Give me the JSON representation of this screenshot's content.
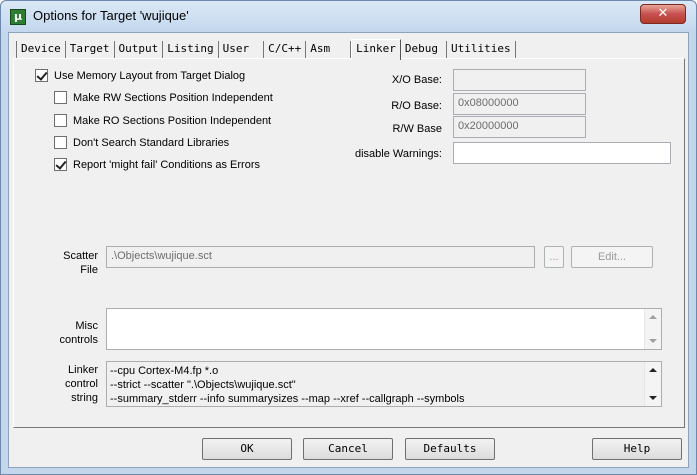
{
  "window": {
    "title": "Options for Target 'wujique'",
    "icon_text": "μ",
    "close_glyph": "✕"
  },
  "tabs": [
    {
      "label": "Device"
    },
    {
      "label": "Target"
    },
    {
      "label": "Output"
    },
    {
      "label": "Listing"
    },
    {
      "label": "User"
    },
    {
      "label": "C/C++"
    },
    {
      "label": "Asm"
    },
    {
      "label": "Linker"
    },
    {
      "label": "Debug"
    },
    {
      "label": "Utilities"
    }
  ],
  "active_tab": "Linker",
  "linker": {
    "use_memory_layout": {
      "label": "Use Memory Layout from Target Dialog",
      "checked": true
    },
    "make_rw_independent": {
      "label": "Make RW Sections Position Independent",
      "checked": false
    },
    "make_ro_independent": {
      "label": "Make RO Sections Position Independent",
      "checked": false
    },
    "dont_search_std_libs": {
      "label": "Don't Search Standard Libraries",
      "checked": false
    },
    "report_might_fail": {
      "label": "Report 'might fail' Conditions as Errors",
      "checked": true
    },
    "xo_base": {
      "label": "X/O Base:",
      "value": ""
    },
    "ro_base": {
      "label": "R/O Base:",
      "value": "0x08000000"
    },
    "rw_base": {
      "label": "R/W Base",
      "value": "0x20000000"
    },
    "disable_warnings": {
      "label": "disable Warnings:",
      "value": ""
    },
    "scatter_file": {
      "label_line1": "Scatter",
      "label_line2": "File",
      "value": ".\\Objects\\wujique.sct",
      "browse_label": "...",
      "edit_label": "Edit..."
    },
    "misc_controls": {
      "label_line1": "Misc",
      "label_line2": "controls",
      "value": ""
    },
    "linker_control_string": {
      "label_line1": "Linker",
      "label_line2": "control",
      "label_line3": "string",
      "lines": [
        "--cpu Cortex-M4.fp *.o",
        "--strict --scatter \".\\Objects\\wujique.sct\"",
        "--summary_stderr --info summarysizes --map --xref --callgraph --symbols"
      ]
    }
  },
  "buttons": {
    "ok": "OK",
    "cancel": "Cancel",
    "defaults": "Defaults",
    "help": "Help"
  },
  "colors": {
    "title_bar": "#c4d8ee",
    "dialog_bg": "#f0f0f0",
    "close_button": "#c75050"
  }
}
